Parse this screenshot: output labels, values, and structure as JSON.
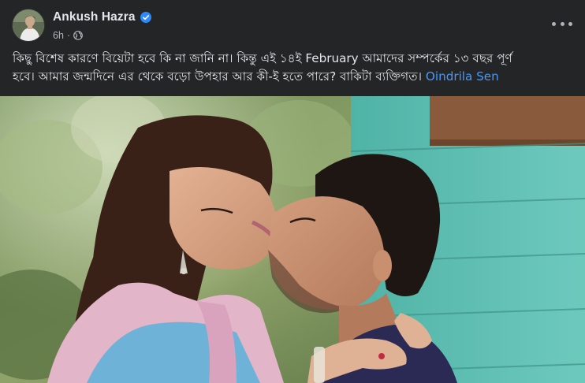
{
  "post": {
    "author": "Ankush Hazra",
    "verified": true,
    "time": "6h",
    "separator": "·",
    "audience_icon": "globe-icon",
    "more_icon": "more-options-icon",
    "caption_line1": "কিছু বিশেষ কারণে বিয়েটা হবে কি না জানি না। কিন্তু এই ১৪ই February আমাদের সম্পর্কের ১৩ বছর পূর্ণ",
    "caption_line2": "হবে। আমার জন্মদিনে এর থেকে বড়ো উপহার আর কী-ই হতে পারে? বাকিটা ব্যক্তিগত।",
    "tagged_user": "Oindrila Sen"
  },
  "colors": {
    "background": "#242526",
    "primary_text": "#e4e6eb",
    "secondary_text": "#b0b3b8",
    "link": "#4599ff",
    "verified_badge": "#2d88ff"
  }
}
